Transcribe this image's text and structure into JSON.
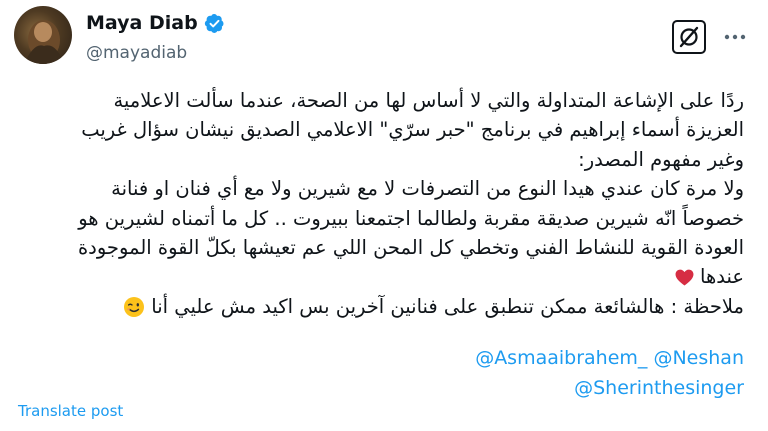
{
  "author": {
    "display_name": "Maya Diab",
    "handle": "@mayadiab",
    "verified": true
  },
  "icons": {
    "verified": "verified-badge-icon",
    "grok": "grok-icon",
    "more": "more-options-icon",
    "heart": "red-heart-icon",
    "emoji": "winking-face-icon"
  },
  "colors": {
    "accent": "#1d9bf0",
    "text": "#0f1419",
    "secondary": "#536471",
    "heart": "#d62d43"
  },
  "tweet": {
    "lines": [
      "ردًا على الإشاعة المتداولة والتي لا أساس لها من الصحة، عندما سألت الاعلامية",
      "العزيزة أسماء إبراهيم في برنامج \"حبر سرّي\" الاعلامي الصديق نيشان سؤال غريب",
      "وغير مفهوم المصدر:",
      "ولا مرة كان عندي هيدا النوع من التصرفات لا مع شيرين ولا مع أي فنان او فنانة",
      "خصوصاً انّه شيرين صديقة مقربة ولطالما اجتمعنا ببيروت .. كل ما أتمناه لشيرين هو",
      "العودة القوية للنشاط الفني وتخطي كل المحن اللي عم تعيشها بكلّ القوة الموجودة",
      "عندها",
      "ملاحظة : هالشائعة ممكن تنطبق على فنانين آخرين بس اكيد مش عليي أنا"
    ],
    "mentions": [
      "@Asmaaibrahem_",
      "@Neshan",
      "@Sherinthesinger"
    ]
  },
  "translate_label": "Translate post"
}
